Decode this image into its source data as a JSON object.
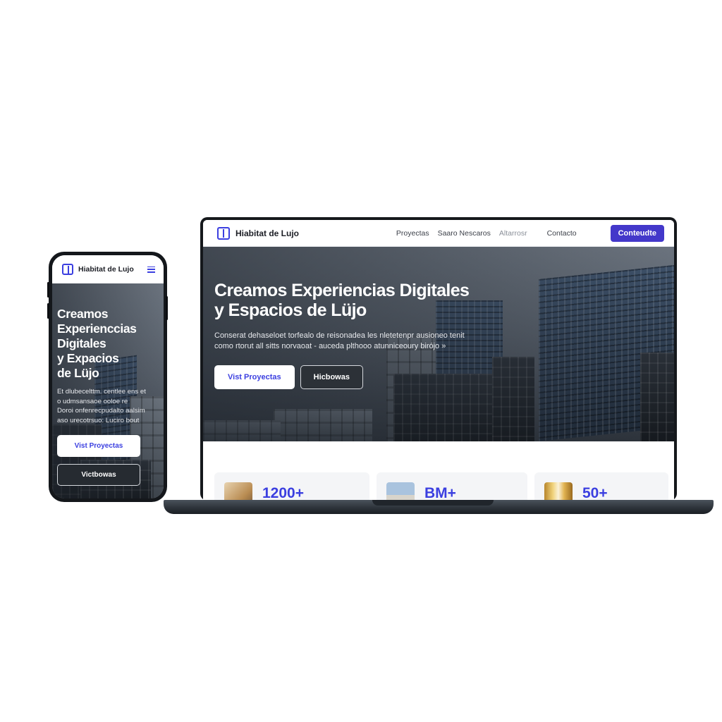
{
  "brand": {
    "name": "Hiabitat de Lujo",
    "accent": "#4338ca"
  },
  "laptop": {
    "nav": {
      "links": [
        "Proyectas",
        "Saaro Nescaros",
        "Altarrosr",
        "Contacto"
      ],
      "cta": "Conteudte"
    },
    "hero": {
      "title_line1": "Creamos Experiencias Digitales",
      "title_line2": "y Espacios de Lüjo",
      "subtitle_line1": "Conserat dehaseloet torfealo de reisonadea les nletetenpr ausioneo tenit",
      "subtitle_line2": "como rtorut all sitts norvaoat - auceda plthooo atunniceoury birójo »",
      "primary_button": "Vist Proyectas",
      "secondary_button": "Hicbowas"
    },
    "stats": [
      {
        "value": "1200+",
        "thumb": "interior"
      },
      {
        "value": "BM+",
        "thumb": "building"
      },
      {
        "value": "50+",
        "thumb": "gold-arch"
      }
    ]
  },
  "phone": {
    "brand": "Hiabitat de Lujo",
    "menu_icon": "hamburger-icon",
    "hero": {
      "title_lines": [
        "Creamos",
        "Experienccias",
        "Digitales",
        "y Expacios",
        "de Lüjo"
      ],
      "subtitle_lines": [
        "Et dlubecelttm. centlee ens et",
        "o udmsansaoe ooloe re",
        "Doroi onfenrecpudalto aalsim",
        "aso urecotrsuo: Luciro bout"
      ],
      "primary_button": "Vist Proyectas",
      "secondary_button": "Victbowas"
    }
  }
}
